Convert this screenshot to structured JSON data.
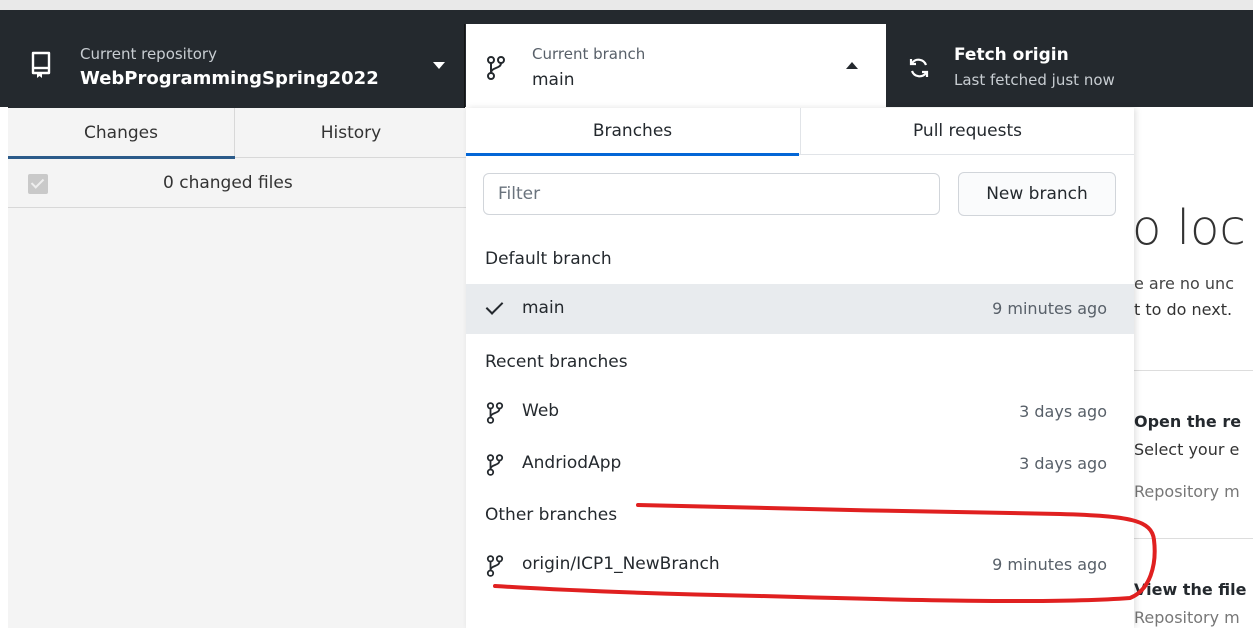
{
  "toolbar": {
    "repo": {
      "label": "Current repository",
      "name": "WebProgrammingSpring2022"
    },
    "branch": {
      "label": "Current branch",
      "name": "main"
    },
    "fetch": {
      "title": "Fetch origin",
      "status": "Last fetched just now"
    }
  },
  "sidebar": {
    "tabs": [
      {
        "label": "Changes"
      },
      {
        "label": "History"
      }
    ],
    "changed_files": "0 changed files"
  },
  "dropdown": {
    "tabs": [
      {
        "label": "Branches"
      },
      {
        "label": "Pull requests"
      }
    ],
    "filter_placeholder": "Filter",
    "new_branch_label": "New branch",
    "default_heading": "Default branch",
    "default_branches": [
      {
        "name": "main",
        "time": "9 minutes ago"
      }
    ],
    "recent_heading": "Recent branches",
    "recent_branches": [
      {
        "name": "Web",
        "time": "3 days ago"
      },
      {
        "name": "AndriodApp",
        "time": "3 days ago"
      }
    ],
    "other_heading": "Other branches",
    "other_branches": [
      {
        "name": "origin/ICP1_NewBranch",
        "time": "9 minutes ago"
      }
    ]
  },
  "background": {
    "heading_fragment": "o loc",
    "line1": "e are no unc",
    "line2": "t to do next.",
    "open_heading": "Open the re",
    "open_sub": "Select your e",
    "open_meta": "Repository m",
    "view_heading": "View the file",
    "view_meta": "Repository m"
  },
  "colors": {
    "toolbar_bg": "#24292e",
    "accent": "#0366d6",
    "annotation": "#e02020"
  },
  "icons": {
    "repo": "repo-icon",
    "branch": "git-branch-icon",
    "fetch": "sync-icon",
    "check": "checkmark-icon"
  }
}
